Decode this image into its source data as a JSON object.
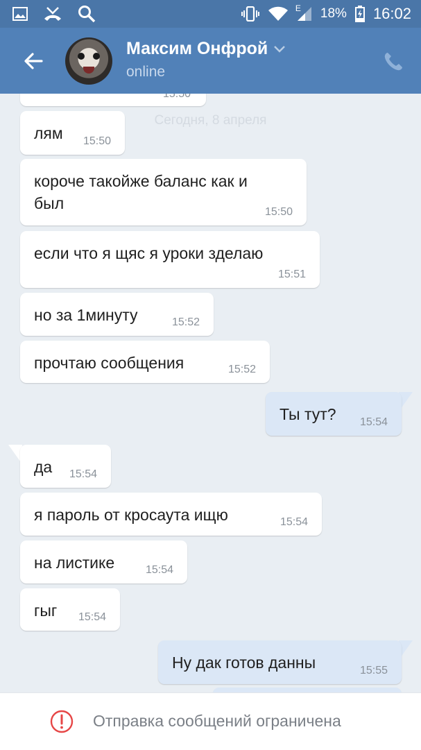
{
  "status_bar": {
    "network_label": "E",
    "battery": "18%",
    "time": "16:02",
    "icons": [
      "image-icon",
      "missed-call-icon",
      "search-icon",
      "vibrate-icon",
      "wifi-icon",
      "signal-icon",
      "battery-icon"
    ]
  },
  "header": {
    "name": "Максим Онфрой",
    "status": "online"
  },
  "chat": {
    "partial_time": "15:50",
    "date_divider": "Сегодня, 8 апреля",
    "messages": [
      {
        "dir": "in",
        "text": "лям",
        "time": "15:50"
      },
      {
        "dir": "in",
        "text": "короче такойже баланс как и\nбыл",
        "time": "15:50"
      },
      {
        "dir": "in",
        "text": "если что я щяс я уроки зделаю",
        "time": "15:51"
      },
      {
        "dir": "in",
        "text": "но за 1минуту",
        "time": "15:52"
      },
      {
        "dir": "in",
        "text": "прочтаю сообщения",
        "time": "15:52"
      },
      {
        "dir": "out",
        "text": "Ты тут?",
        "time": "15:54"
      },
      {
        "dir": "in",
        "text": "да",
        "time": "15:54"
      },
      {
        "dir": "in",
        "text": "я пароль от кросаута ищю",
        "time": "15:54"
      },
      {
        "dir": "in",
        "text": "на листике",
        "time": "15:54"
      },
      {
        "dir": "in",
        "text": "гыг",
        "time": "15:54"
      },
      {
        "dir": "out",
        "text": "Ну дак готов данны",
        "time": "15:55"
      }
    ]
  },
  "bottom_bar": {
    "notice": "Отправка сообщений ограничена"
  },
  "colors": {
    "header": "#5181b8",
    "status_bar": "#4a76a8",
    "chat_bg": "#e9eef3",
    "incoming": "#ffffff",
    "outgoing": "#dbe7f6",
    "warning": "#e64646"
  }
}
